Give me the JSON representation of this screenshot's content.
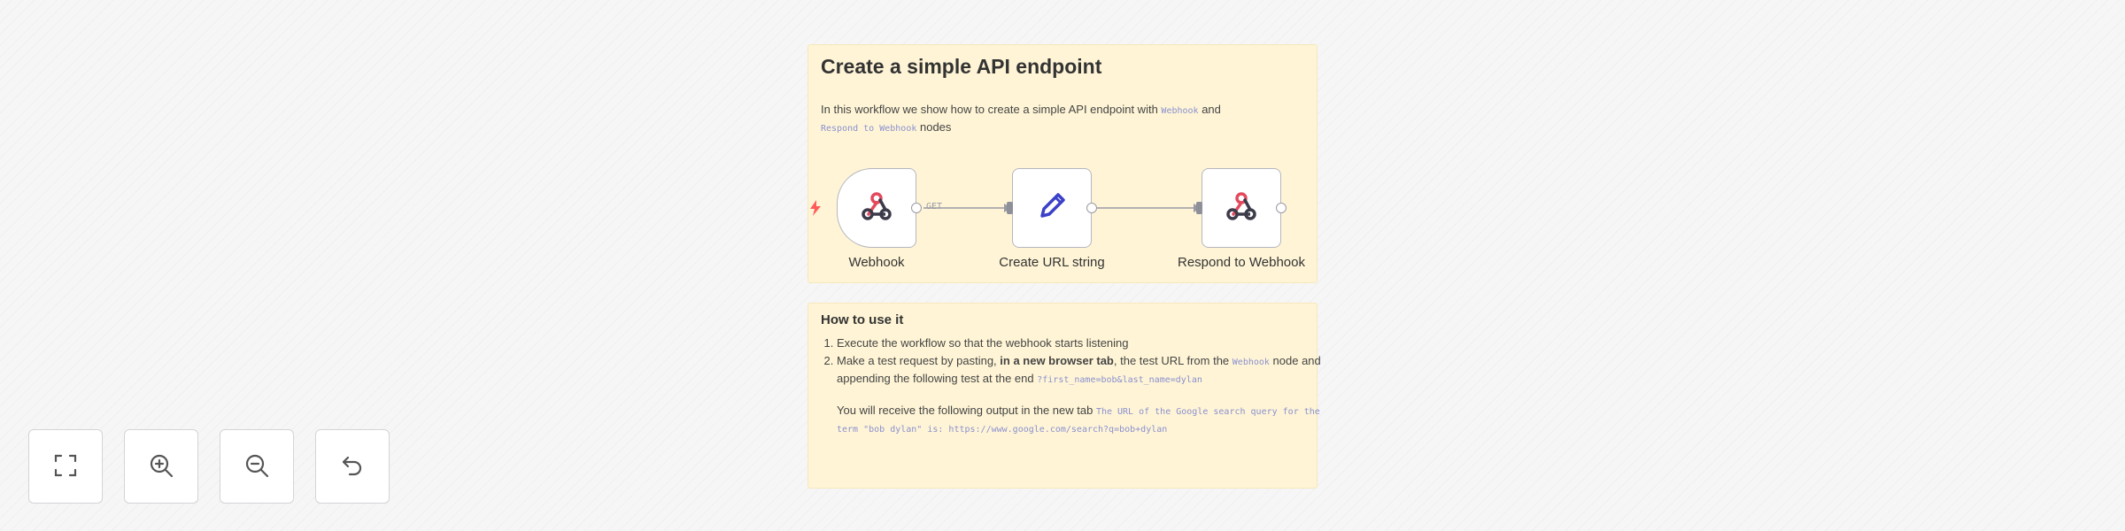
{
  "sticky_main": {
    "title": "Create a simple API endpoint",
    "intro_before": "In this workflow we show how to create a simple API endpoint with ",
    "intro_code1": "Webhook",
    "intro_middle": " and ",
    "intro_code2": "Respond to Webhook",
    "intro_after": " nodes"
  },
  "nodes": [
    {
      "label": "Webhook",
      "icon": "webhook-icon"
    },
    {
      "label": "Create URL string",
      "icon": "pencil-icon"
    },
    {
      "label": "Respond to Webhook",
      "icon": "webhook-icon"
    }
  ],
  "edge_label": "GET",
  "trigger_icon": "bolt-icon",
  "sticky_howto": {
    "title": "How to use it",
    "step1": "Execute the workflow so that the webhook starts listening",
    "step2_before": "Make a test request by pasting, ",
    "step2_bold": "in a new browser tab",
    "step2_middle": ", the test URL from the ",
    "step2_code": "Webhook",
    "step2_after": " node and appending the following test at the end ",
    "step2_code2": "?first_name=bob&last_name=dylan",
    "output_before": "You will receive the following output in the new tab ",
    "output_code": "The URL of the Google search query for the term \"bob dylan\" is: https://www.google.com/search?q=bob+dylan"
  },
  "controls": [
    {
      "name": "fit-view",
      "icon": "fit-view-icon"
    },
    {
      "name": "zoom-in",
      "icon": "zoom-in-icon"
    },
    {
      "name": "zoom-out",
      "icon": "zoom-out-icon"
    },
    {
      "name": "reset-zoom",
      "icon": "undo-icon"
    }
  ],
  "colors": {
    "sticky_bg": "#fff5d6",
    "code_text": "#8a8fd0",
    "webhook_red": "#e34a5d",
    "webhook_dark": "#3b3b4a",
    "pencil_blue": "#3b40c8",
    "trigger_bolt": "#ff5b5b"
  }
}
